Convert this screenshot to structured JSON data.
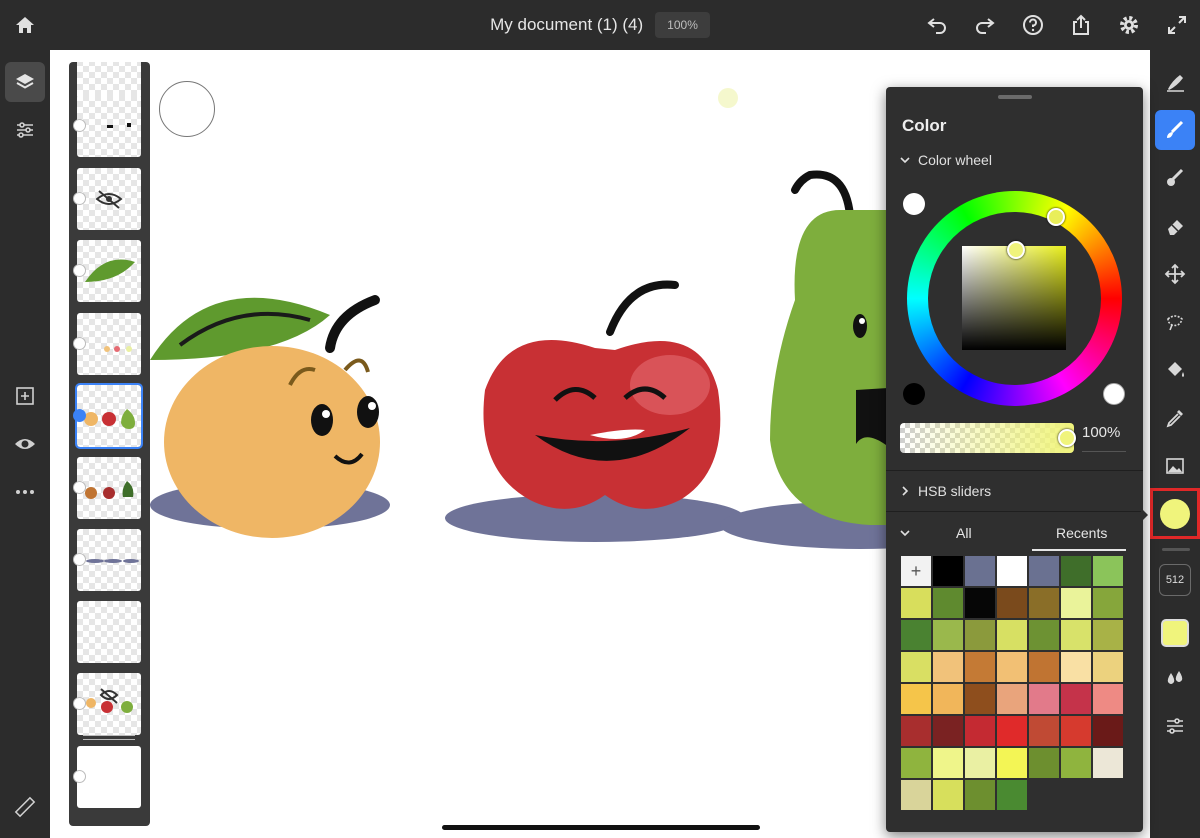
{
  "topbar": {
    "title": "My document (1) (4)",
    "zoom": "100%",
    "icons": [
      "home-icon",
      "undo-icon",
      "redo-icon",
      "help-icon",
      "share-icon",
      "settings-icon",
      "fullscreen-icon"
    ]
  },
  "left_rail": {
    "icons": [
      "layers-icon",
      "layer-properties-icon",
      "add-layer-icon",
      "visibility-icon",
      "more-icon",
      "ruler-icon"
    ]
  },
  "layers": {
    "selected_index": 4,
    "count": 11
  },
  "right_rail": {
    "tools": [
      "smudge-icon",
      "pixel-brush-icon",
      "live-brush-icon",
      "eraser-icon",
      "transform-icon",
      "lasso-icon",
      "fill-icon",
      "eyedropper-icon",
      "image-icon"
    ],
    "active_tool": "pixel-brush-icon",
    "brush_size": "512",
    "current_color": "#f0f47c"
  },
  "color_panel": {
    "title": "Color",
    "wheel_section": "Color wheel",
    "opacity": "100%",
    "hsb_section": "HSB sliders",
    "tabs": {
      "all": "All",
      "recents": "Recents",
      "active": "recents"
    },
    "add_label": "+",
    "swatches": [
      "#000000",
      "#6a7191",
      "#ffffff",
      "#6a7191",
      "#3f6e2a",
      "#8bc45a",
      "#d8de5c",
      "#5f8a2f",
      "#060606",
      "#7a4a1c",
      "#8a6e28",
      "#eaf39a",
      "#86a63b",
      "#4a8231",
      "#9ab84c",
      "#8b9a3c",
      "#d7e063",
      "#6d9233",
      "#d8e26a",
      "#a8b247",
      "#d9df63",
      "#f1c27a",
      "#c47a35",
      "#f2c074",
      "#c07432",
      "#f9e0a4",
      "#ecd27e",
      "#f5c54a",
      "#f1b65a",
      "#8e4e1d",
      "#e9a47c",
      "#e27a8a",
      "#c5334a",
      "#ee8a84",
      "#a82e2e",
      "#7a2222",
      "#c42a32",
      "#e02a2a",
      "#c04a34",
      "#d63a2e",
      "#6a1a18",
      "#8fb43e",
      "#eff58a",
      "#eaf0a3",
      "#f3f555",
      "#6d8f2f",
      "#8fb43e",
      "#ece7d7",
      "#d9d49a",
      "#d7df5c",
      "#6d8f2f",
      "#4a8a31"
    ]
  },
  "colors": {
    "accent": "#3b82f6",
    "highlight": "#e02828",
    "chrome": "#2c2c2c"
  }
}
